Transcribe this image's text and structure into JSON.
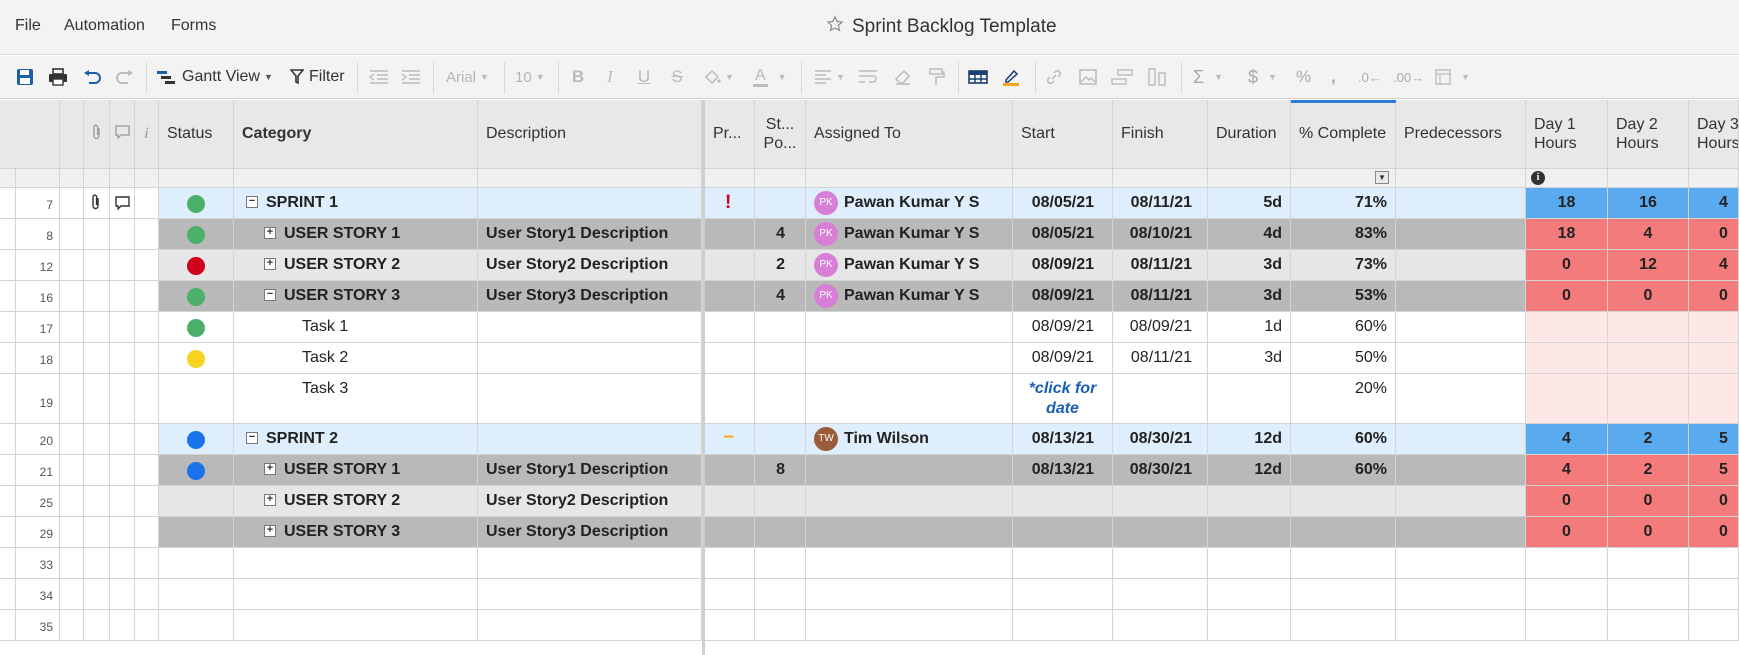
{
  "menu": {
    "file": "File",
    "automation": "Automation",
    "forms": "Forms"
  },
  "document": {
    "title": "Sprint Backlog Template"
  },
  "toolbar": {
    "view_label": "Gantt View",
    "filter_label": "Filter",
    "font_name": "Arial",
    "font_size": "10",
    "icons": [
      "save-icon",
      "print-icon",
      "undo-icon",
      "redo-icon",
      "gantt-icon",
      "filter-icon",
      "outdent-icon",
      "indent-icon",
      "bold-icon",
      "italic-icon",
      "underline-icon",
      "strikethrough-icon",
      "fill-color-icon",
      "text-color-icon",
      "align-icon",
      "wrap-icon",
      "clear-format-icon",
      "format-painter-icon",
      "highlight-grid-icon",
      "highlight-changes-icon",
      "link-icon",
      "image-icon",
      "insert-row-icon",
      "insert-col-icon",
      "sum-icon",
      "currency-icon",
      "percent-icon",
      "thousands-icon",
      "decrease-decimal-icon",
      "increase-decimal-icon",
      "format-icon"
    ]
  },
  "columns": {
    "status": "Status",
    "category": "Category",
    "description": "Description",
    "priority": "Pr...",
    "story_points_1": "St...",
    "story_points_2": "Po...",
    "assigned_to": "Assigned To",
    "start": "Start",
    "finish": "Finish",
    "duration": "Duration",
    "complete": "% Complete",
    "predecessors": "Predecessors",
    "day1_a": "Day 1",
    "day1_b": "Hours",
    "day2_a": "Day 2",
    "day2_b": "Hours",
    "day3_a": "Day 3",
    "day3_b": "Hours"
  },
  "colors": {
    "sprint_bg": "#deeefc",
    "story_dark_bg": "#b9b9b9",
    "story_light_bg": "#e6e6e6",
    "hours_blue": "#5aaaf0",
    "hours_red": "#f47b7b",
    "hours_pink": "#fde7e7",
    "status_green": "#4caf6a",
    "status_red": "#d0021b",
    "status_yellow": "#f5d31f",
    "status_blue": "#1a73e8"
  },
  "rows": [
    {
      "num": "7",
      "type": "sprint",
      "attach": true,
      "comment": true,
      "status": "green",
      "toggle": "−",
      "name": "SPRINT 1",
      "desc": "",
      "priority": "!",
      "points": "",
      "avatar": "PK",
      "assigned": "Pawan Kumar Y S",
      "start": "08/05/21",
      "finish": "08/11/21",
      "duration": "5d",
      "complete": "71%",
      "d1": "18",
      "d2": "16",
      "d3": "4"
    },
    {
      "num": "8",
      "type": "story_dark",
      "status": "green",
      "toggle": "+",
      "name": "USER STORY 1",
      "desc": "User Story1 Description",
      "points": "4",
      "avatar": "PK",
      "assigned": "Pawan Kumar Y S",
      "start": "08/05/21",
      "finish": "08/10/21",
      "duration": "4d",
      "complete": "83%",
      "d1": "18",
      "d2": "4",
      "d3": "0"
    },
    {
      "num": "12",
      "type": "story_light",
      "status": "red",
      "toggle": "+",
      "name": "USER STORY 2",
      "desc": "User Story2 Description",
      "points": "2",
      "avatar": "PK",
      "assigned": "Pawan Kumar Y S",
      "start": "08/09/21",
      "finish": "08/11/21",
      "duration": "3d",
      "complete": "73%",
      "d1": "0",
      "d2": "12",
      "d3": "4"
    },
    {
      "num": "16",
      "type": "story_dark",
      "status": "green",
      "toggle": "−",
      "name": "USER STORY 3",
      "desc": "User Story3 Description",
      "points": "4",
      "avatar": "PK",
      "assigned": "Pawan Kumar Y S",
      "start": "08/09/21",
      "finish": "08/11/21",
      "duration": "3d",
      "complete": "53%",
      "d1": "0",
      "d2": "0",
      "d3": "0"
    },
    {
      "num": "17",
      "type": "task",
      "status": "green",
      "name": "Task 1",
      "start": "08/09/21",
      "finish": "08/09/21",
      "duration": "1d",
      "complete": "60%"
    },
    {
      "num": "18",
      "type": "task",
      "status": "yellow",
      "name": "Task 2",
      "start": "08/09/21",
      "finish": "08/11/21",
      "duration": "3d",
      "complete": "50%"
    },
    {
      "num": "19",
      "type": "task_tall",
      "name": "Task 3",
      "start_link_1": "*click for",
      "start_link_2": "date",
      "complete": "20%"
    },
    {
      "num": "20",
      "type": "sprint",
      "status": "blue",
      "toggle": "−",
      "name": "SPRINT 2",
      "priority": "−",
      "avatar": "TW",
      "assigned": "Tim Wilson",
      "start": "08/13/21",
      "finish": "08/30/21",
      "duration": "12d",
      "complete": "60%",
      "d1": "4",
      "d2": "2",
      "d3": "5"
    },
    {
      "num": "21",
      "type": "story_dark",
      "status": "blue",
      "toggle": "+",
      "name": "USER STORY 1",
      "desc": "User Story1 Description",
      "points": "8",
      "start": "08/13/21",
      "finish": "08/30/21",
      "duration": "12d",
      "complete": "60%",
      "d1": "4",
      "d2": "2",
      "d3": "5"
    },
    {
      "num": "25",
      "type": "story_light",
      "toggle": "+",
      "name": "USER STORY 2",
      "desc": "User Story2 Description",
      "d1": "0",
      "d2": "0",
      "d3": "0"
    },
    {
      "num": "29",
      "type": "story_dark",
      "toggle": "+",
      "name": "USER STORY 3",
      "desc": "User Story3 Description",
      "d1": "0",
      "d2": "0",
      "d3": "0"
    },
    {
      "num": "33",
      "type": "empty"
    },
    {
      "num": "34",
      "type": "empty"
    },
    {
      "num": "35",
      "type": "empty"
    }
  ]
}
